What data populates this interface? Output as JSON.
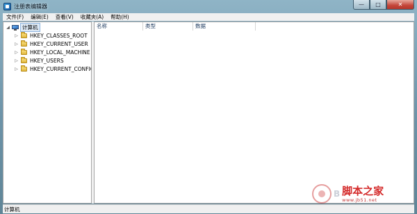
{
  "window": {
    "title": "注册表编辑器",
    "controls": {
      "minimize": "—",
      "maximize": "□",
      "close": "✕"
    }
  },
  "menubar": {
    "items": [
      {
        "label": "文件(F)"
      },
      {
        "label": "编辑(E)"
      },
      {
        "label": "查看(V)"
      },
      {
        "label": "收藏夹(A)"
      },
      {
        "label": "帮助(H)"
      }
    ]
  },
  "tree": {
    "root": {
      "label": "计算机",
      "icon": "computer-icon",
      "expander": "◢"
    },
    "children": [
      {
        "label": "HKEY_CLASSES_ROOT",
        "icon": "folder-icon",
        "expander": "▷"
      },
      {
        "label": "HKEY_CURRENT_USER",
        "icon": "folder-icon",
        "expander": "▷"
      },
      {
        "label": "HKEY_LOCAL_MACHINE",
        "icon": "folder-icon",
        "expander": "▷"
      },
      {
        "label": "HKEY_USERS",
        "icon": "folder-icon",
        "expander": "▷"
      },
      {
        "label": "HKEY_CURRENT_CONFIG",
        "icon": "folder-icon",
        "expander": "▷"
      }
    ]
  },
  "list": {
    "columns": [
      {
        "label": "名称"
      },
      {
        "label": "类型"
      },
      {
        "label": "数据"
      }
    ]
  },
  "statusbar": {
    "text": "计算机"
  },
  "watermark": {
    "faint": "B",
    "text": "脚本之家",
    "url": "www.jb51.net"
  },
  "colors": {
    "selection": "#dde9f5",
    "selection_border": "#8eb4de",
    "close_button": "#c4463a",
    "header_text": "#1e3a5f",
    "watermark_red": "#d42a2a"
  }
}
